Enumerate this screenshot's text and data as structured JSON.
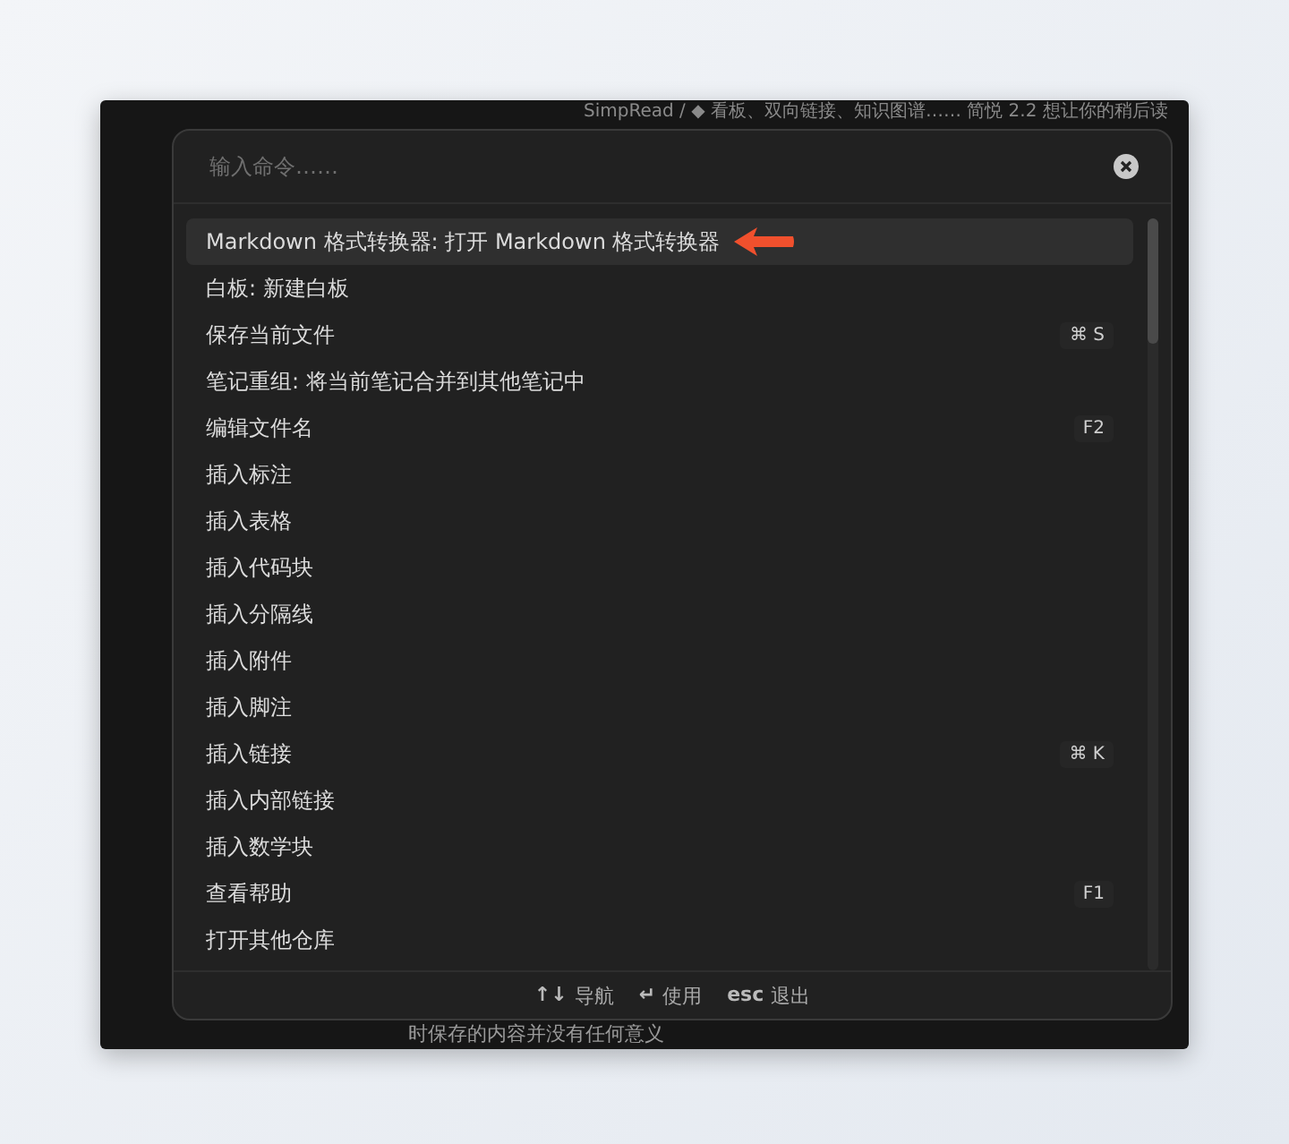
{
  "background_document": {
    "top_line": "SimpRead / ◆ 看板、双向链接、知识图谱…… 简悦 2.2 想让你的稍后读",
    "bottom_line": "时保存的内容并没有任何意义"
  },
  "command_palette": {
    "placeholder": "输入命令……",
    "commands": [
      {
        "label": "Markdown 格式转换器: 打开 Markdown 格式转换器",
        "selected": true,
        "annotated": true
      },
      {
        "label": "白板: 新建白板",
        "selected": false
      },
      {
        "label": "保存当前文件",
        "selected": false,
        "shortcut": "⌘ S"
      },
      {
        "label": "笔记重组: 将当前笔记合并到其他笔记中",
        "selected": false
      },
      {
        "label": "编辑文件名",
        "selected": false,
        "shortcut": "F2"
      },
      {
        "label": "插入标注",
        "selected": false
      },
      {
        "label": "插入表格",
        "selected": false
      },
      {
        "label": "插入代码块",
        "selected": false
      },
      {
        "label": "插入分隔线",
        "selected": false
      },
      {
        "label": "插入附件",
        "selected": false
      },
      {
        "label": "插入脚注",
        "selected": false
      },
      {
        "label": "插入链接",
        "selected": false,
        "shortcut": "⌘ K"
      },
      {
        "label": "插入内部链接",
        "selected": false
      },
      {
        "label": "插入数学块",
        "selected": false
      },
      {
        "label": "查看帮助",
        "selected": false,
        "shortcut": "F1"
      },
      {
        "label": "打开其他仓库",
        "selected": false
      }
    ],
    "instructions": [
      {
        "keys": "↑↓",
        "label": "导航"
      },
      {
        "keys": "↵",
        "label": "使用"
      },
      {
        "keys": "esc",
        "label": "退出"
      }
    ]
  }
}
